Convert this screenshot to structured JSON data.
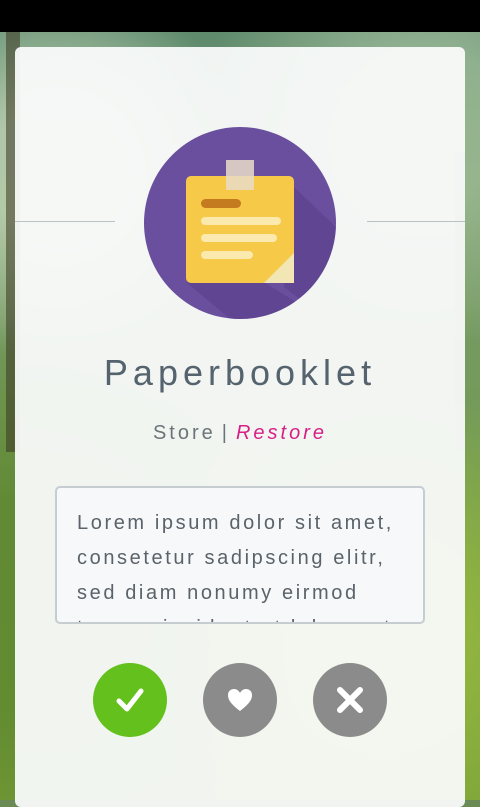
{
  "app": {
    "name": "Paperbooklet",
    "store_label": "Store",
    "separator": "|",
    "restore_label": "Restore",
    "description": "Lorem ipsum dolor sit amet, consetetur sadipscing elitr, sed diam nonumy eirmod tempor invidunt ut labore et dolore magna aliquyam erat"
  },
  "icons": {
    "app_icon": "sticky-note-icon",
    "accept": "checkmark-icon",
    "favorite": "heart-icon",
    "reject": "close-icon"
  },
  "colors": {
    "accent": "#d81f86",
    "accept": "#64c01c",
    "neutral_button": "#8b8b8b",
    "icon_circle": "#6a4f9e",
    "note": "#f7c948"
  }
}
